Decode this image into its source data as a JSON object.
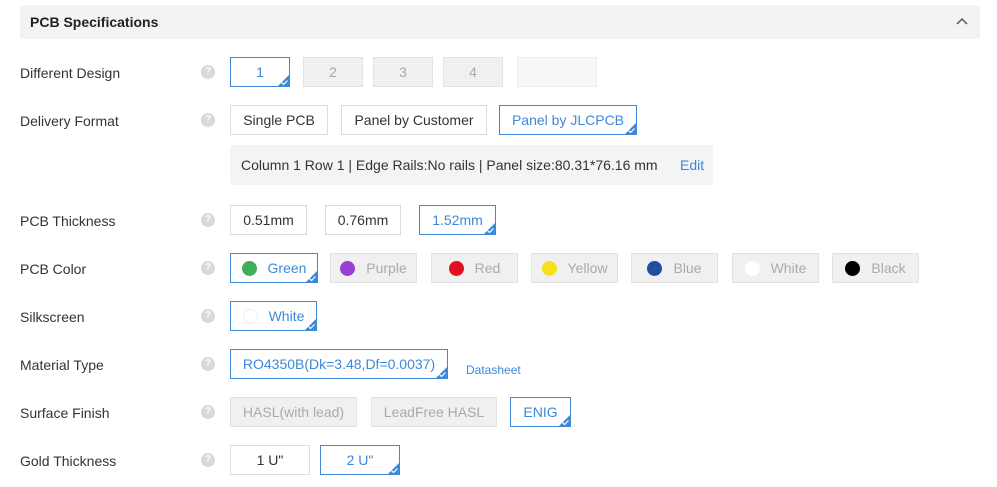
{
  "header": {
    "title": "PCB Specifications",
    "collapse_icon": "chevron-up-icon"
  },
  "rows": {
    "different_design": {
      "label": "Different Design",
      "options": [
        "1",
        "2",
        "3",
        "4",
        ""
      ],
      "selected": "1"
    },
    "delivery_format": {
      "label": "Delivery Format",
      "options": [
        "Single PCB",
        "Panel by Customer",
        "Panel by JLCPCB"
      ],
      "selected": "Panel by JLCPCB",
      "panel_info": "Column 1 Row 1 | Edge Rails:No rails | Panel size:80.31*76.16 mm",
      "edit_label": "Edit"
    },
    "pcb_thickness": {
      "label": "PCB Thickness",
      "options": [
        "0.51mm",
        "0.76mm",
        "1.52mm"
      ],
      "selected": "1.52mm"
    },
    "pcb_color": {
      "label": "PCB Color",
      "options": [
        "Green",
        "Purple",
        "Red",
        "Yellow",
        "Blue",
        "White",
        "Black"
      ],
      "colors": {
        "Green": "#3fae5a",
        "Purple": "#9b3fd1",
        "Red": "#e0101e",
        "Yellow": "#f5e11a",
        "Blue": "#1f4f9e",
        "White": "#ffffff",
        "Black": "#000000"
      },
      "selected": "Green"
    },
    "silkscreen": {
      "label": "Silkscreen",
      "options": [
        "White"
      ],
      "selected": "White"
    },
    "material_type": {
      "label": "Material Type",
      "options": [
        "RO4350B(Dk=3.48,Df=0.0037)"
      ],
      "selected": "RO4350B(Dk=3.48,Df=0.0037)",
      "datasheet_label": "Datasheet"
    },
    "surface_finish": {
      "label": "Surface Finish",
      "options": [
        "HASL(with lead)",
        "LeadFree HASL",
        "ENIG"
      ],
      "selected": "ENIG"
    },
    "gold_thickness": {
      "label": "Gold Thickness",
      "options": [
        "1 U\"",
        "2 U\""
      ],
      "selected": "2 U\""
    }
  },
  "help_icon": "question-circle-icon",
  "help_glyph": "?",
  "accent_color": "#3e88d8"
}
